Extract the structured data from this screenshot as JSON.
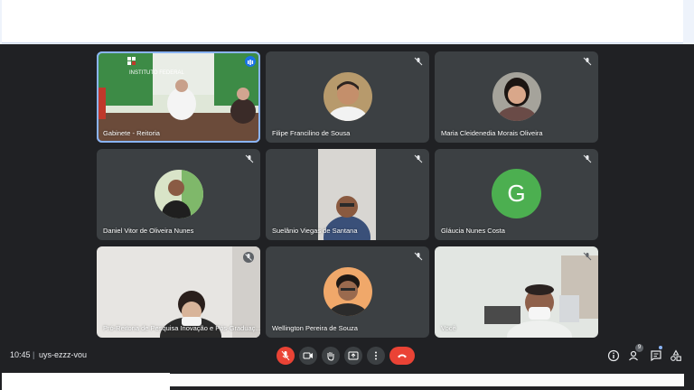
{
  "meeting": {
    "time": "10:45",
    "separator": "|",
    "code": "uys-ezzz-vou",
    "participant_count": "9"
  },
  "participants": [
    {
      "name": "Gabinete - Reitoria",
      "speaking": true,
      "sign_text": "INSTITUTO FEDERAL"
    },
    {
      "name": "Filipe Francilino de Sousa",
      "muted": true
    },
    {
      "name": "Maria Cleidenedia Morais Oliveira",
      "muted": true
    },
    {
      "name": "Daniel Vitor de Oliveira Nunes",
      "muted": true
    },
    {
      "name": "Suelânio Viegas de Santana",
      "muted": true
    },
    {
      "name": "Gláucia Nunes Costa",
      "muted": true,
      "avatar_letter": "G",
      "avatar_color": "#4caf50"
    },
    {
      "name": "Pró-Reitoria de Pesquisa Inovação e Pós-Graduaç...",
      "muted": true
    },
    {
      "name": "Wellington Pereira de Souza",
      "muted": true
    },
    {
      "name": "Você",
      "muted": true
    }
  ],
  "controls": {
    "items": [
      "microphone-off-icon",
      "camera-icon",
      "raise-hand-icon",
      "present-screen-icon",
      "more-options-icon",
      "end-call-icon"
    ],
    "right_items": [
      "info-icon",
      "people-icon",
      "chat-icon",
      "activities-icon"
    ]
  },
  "colors": {
    "background": "#202124",
    "tile": "#3c4043",
    "accent": "#8ab4f8",
    "danger": "#ea4335"
  }
}
